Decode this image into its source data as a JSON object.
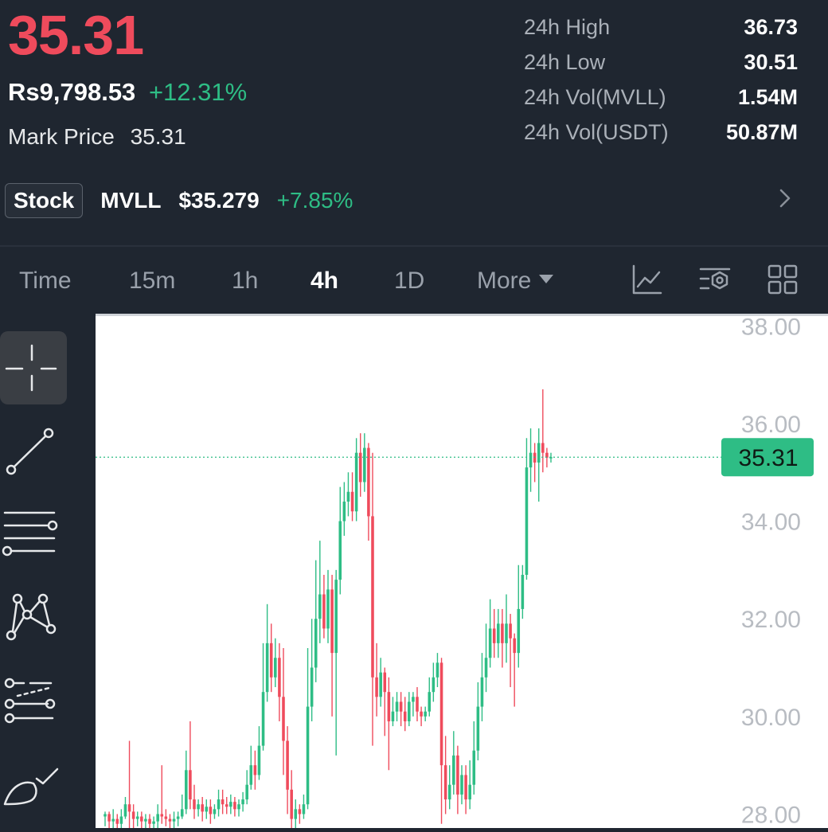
{
  "header": {
    "last_price": "35.31",
    "fiat_price": "Rs9,798.53",
    "change_pct": "+12.31%",
    "mark_price_label": "Mark Price",
    "mark_price_value": "35.31",
    "stats": [
      {
        "label": "24h High",
        "value": "36.73"
      },
      {
        "label": "24h Low",
        "value": "30.51"
      },
      {
        "label": "24h Vol(MVLL)",
        "value": "1.54M"
      },
      {
        "label": "24h Vol(USDT)",
        "value": "50.87M"
      }
    ],
    "ticker": {
      "badge": "Stock",
      "symbol": "MVLL",
      "price": "$35.279",
      "change": "+7.85%"
    }
  },
  "tabs": {
    "items": [
      {
        "label": "Time",
        "active": false
      },
      {
        "label": "15m",
        "active": false
      },
      {
        "label": "1h",
        "active": false
      },
      {
        "label": "4h",
        "active": true
      },
      {
        "label": "1D",
        "active": false
      },
      {
        "label": "More",
        "active": false
      }
    ],
    "tools": [
      "indicator-icon",
      "chart-settings-icon",
      "layout-grid-icon"
    ]
  },
  "sidebar": {
    "tools": [
      "crosshair-icon",
      "trend-line-icon",
      "horizontal-lines-icon",
      "pattern-icon",
      "fibonacci-icon",
      "brush-icon"
    ],
    "active_index": 0
  },
  "chart_data": {
    "type": "candlestick",
    "y_ticks": [
      "38.00",
      "36.00",
      "34.00",
      "32.00",
      "30.00",
      "28.00"
    ],
    "ylim": [
      27.6,
      38.2
    ],
    "current_price_label": "35.31",
    "current_price": 35.31,
    "colors": {
      "up": "#2ebd85",
      "down": "#ef4b5c",
      "axis_text": "#b8bcc2"
    },
    "candles": [
      [
        27.95,
        28.0,
        27.75,
        28.05
      ],
      [
        28.0,
        27.85,
        27.7,
        28.05
      ],
      [
        27.85,
        27.9,
        27.7,
        28.1
      ],
      [
        27.9,
        27.8,
        27.6,
        28.0
      ],
      [
        27.8,
        27.95,
        27.65,
        28.1
      ],
      [
        27.95,
        28.2,
        27.9,
        28.35
      ],
      [
        28.2,
        28.05,
        27.7,
        29.5
      ],
      [
        28.05,
        27.9,
        27.7,
        28.2
      ],
      [
        27.9,
        27.95,
        27.75,
        28.05
      ],
      [
        27.95,
        27.85,
        27.7,
        28.05
      ],
      [
        27.85,
        27.9,
        27.7,
        28.0
      ],
      [
        27.9,
        27.8,
        27.6,
        28.0
      ],
      [
        27.8,
        27.85,
        27.65,
        27.95
      ],
      [
        27.85,
        28.0,
        27.7,
        28.2
      ],
      [
        28.0,
        27.95,
        27.8,
        29.0
      ],
      [
        27.95,
        27.9,
        27.75,
        28.1
      ],
      [
        27.9,
        27.85,
        27.7,
        28.0
      ],
      [
        27.85,
        27.9,
        27.7,
        28.05
      ],
      [
        27.9,
        27.95,
        27.75,
        28.05
      ],
      [
        27.95,
        28.1,
        27.9,
        28.4
      ],
      [
        28.1,
        28.9,
        28.0,
        29.3
      ],
      [
        28.9,
        28.3,
        28.1,
        29.9
      ],
      [
        28.3,
        28.1,
        27.9,
        28.6
      ],
      [
        28.1,
        28.2,
        27.95,
        28.3
      ],
      [
        28.2,
        28.05,
        27.85,
        28.35
      ],
      [
        28.05,
        28.15,
        27.9,
        28.3
      ],
      [
        28.15,
        28.0,
        27.8,
        28.3
      ],
      [
        28.0,
        28.1,
        27.9,
        28.2
      ],
      [
        28.1,
        28.3,
        27.95,
        28.5
      ],
      [
        28.3,
        28.2,
        28.0,
        28.5
      ],
      [
        28.2,
        28.15,
        28.0,
        28.35
      ],
      [
        28.15,
        28.25,
        28.0,
        28.4
      ],
      [
        28.25,
        28.1,
        27.95,
        28.35
      ],
      [
        28.1,
        28.2,
        27.95,
        28.3
      ],
      [
        28.2,
        28.3,
        28.05,
        28.45
      ],
      [
        28.3,
        28.6,
        28.2,
        28.9
      ],
      [
        28.6,
        29.0,
        28.5,
        29.4
      ],
      [
        29.0,
        28.8,
        28.5,
        29.3
      ],
      [
        28.8,
        29.4,
        28.7,
        29.8
      ],
      [
        29.4,
        30.5,
        29.3,
        31.5
      ],
      [
        30.5,
        31.5,
        30.3,
        32.3
      ],
      [
        31.5,
        30.8,
        30.5,
        31.9
      ],
      [
        30.8,
        31.2,
        30.6,
        31.6
      ],
      [
        31.2,
        30.4,
        29.9,
        31.5
      ],
      [
        30.4,
        29.5,
        28.8,
        31.4
      ],
      [
        29.5,
        28.5,
        28.0,
        29.8
      ],
      [
        28.5,
        27.9,
        27.6,
        28.9
      ],
      [
        27.9,
        28.1,
        27.7,
        28.3
      ],
      [
        28.1,
        28.0,
        27.8,
        28.2
      ],
      [
        28.0,
        28.2,
        27.9,
        28.4
      ],
      [
        28.2,
        30.2,
        28.1,
        31.4
      ],
      [
        30.2,
        31.0,
        29.9,
        32.0
      ],
      [
        31.0,
        32.0,
        30.7,
        33.2
      ],
      [
        32.0,
        32.5,
        31.5,
        33.6
      ],
      [
        32.5,
        31.8,
        31.6,
        32.9
      ],
      [
        31.8,
        32.6,
        31.5,
        33.0
      ],
      [
        32.6,
        31.3,
        30.0,
        32.9
      ],
      [
        31.3,
        32.8,
        29.2,
        33.0
      ],
      [
        32.8,
        34.0,
        32.5,
        34.7
      ],
      [
        34.0,
        34.4,
        33.7,
        34.8
      ],
      [
        34.4,
        34.6,
        34.1,
        35.0
      ],
      [
        34.6,
        34.2,
        34.0,
        35.0
      ],
      [
        34.2,
        35.4,
        34.0,
        35.7
      ],
      [
        35.4,
        34.8,
        34.5,
        35.8
      ],
      [
        34.8,
        35.5,
        34.6,
        35.8
      ],
      [
        35.5,
        34.1,
        33.6,
        35.6
      ],
      [
        34.1,
        30.8,
        29.4,
        35.4
      ],
      [
        30.8,
        30.4,
        30.0,
        31.5
      ],
      [
        30.4,
        30.9,
        30.2,
        31.2
      ],
      [
        30.9,
        30.5,
        29.6,
        31.0
      ],
      [
        30.5,
        29.9,
        28.9,
        30.8
      ],
      [
        29.9,
        30.1,
        29.8,
        30.4
      ],
      [
        30.1,
        30.3,
        29.9,
        30.5
      ],
      [
        30.3,
        30.1,
        29.8,
        30.5
      ],
      [
        30.1,
        29.9,
        29.7,
        30.4
      ],
      [
        29.9,
        30.3,
        29.8,
        30.5
      ],
      [
        30.3,
        30.4,
        30.0,
        30.5
      ],
      [
        30.4,
        30.1,
        29.9,
        30.6
      ],
      [
        30.1,
        30.0,
        29.8,
        30.2
      ],
      [
        30.0,
        30.1,
        29.9,
        30.2
      ],
      [
        30.1,
        30.5,
        30.0,
        30.8
      ],
      [
        30.5,
        30.8,
        30.3,
        31.1
      ],
      [
        30.8,
        31.1,
        30.6,
        31.3
      ],
      [
        31.1,
        29.0,
        27.8,
        31.2
      ],
      [
        29.0,
        28.3,
        28.0,
        29.6
      ],
      [
        28.3,
        28.6,
        28.1,
        29.0
      ],
      [
        28.6,
        29.2,
        28.4,
        29.7
      ],
      [
        29.2,
        28.4,
        28.0,
        29.4
      ],
      [
        28.4,
        28.8,
        28.2,
        29.0
      ],
      [
        28.8,
        28.3,
        28.0,
        29.0
      ],
      [
        28.3,
        28.6,
        28.1,
        29.1
      ],
      [
        28.6,
        29.3,
        28.4,
        29.9
      ],
      [
        29.3,
        30.2,
        29.1,
        30.7
      ],
      [
        30.2,
        30.8,
        29.9,
        31.3
      ],
      [
        30.8,
        31.2,
        30.5,
        31.9
      ],
      [
        31.2,
        31.8,
        31.0,
        32.4
      ],
      [
        31.8,
        31.5,
        31.2,
        32.2
      ],
      [
        31.5,
        31.9,
        31.2,
        32.2
      ],
      [
        31.9,
        31.5,
        31.0,
        32.2
      ],
      [
        31.5,
        31.9,
        31.1,
        32.5
      ],
      [
        31.9,
        31.6,
        30.6,
        32.1
      ],
      [
        31.6,
        31.3,
        30.2,
        31.7
      ],
      [
        31.3,
        32.2,
        31.0,
        33.1
      ],
      [
        32.2,
        32.9,
        32.0,
        33.1
      ],
      [
        32.9,
        35.1,
        32.8,
        35.7
      ],
      [
        35.1,
        35.4,
        34.6,
        35.9
      ],
      [
        35.4,
        35.2,
        34.8,
        35.6
      ],
      [
        35.2,
        35.6,
        34.4,
        35.9
      ],
      [
        35.6,
        35.4,
        35.0,
        36.7
      ],
      [
        35.4,
        35.3,
        35.1,
        35.5
      ],
      [
        35.3,
        35.31,
        35.2,
        35.4
      ]
    ]
  }
}
